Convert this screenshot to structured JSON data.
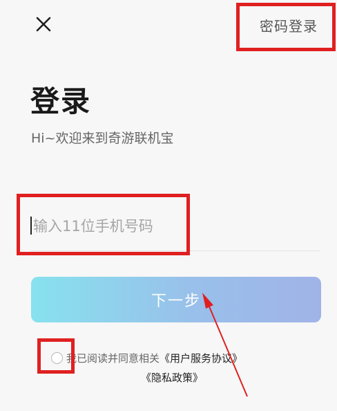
{
  "header": {
    "close_icon": "close-icon",
    "password_login_label": "密码登录"
  },
  "main": {
    "title": "登录",
    "subtitle": "Hi~欢迎来到奇游联机宝",
    "phone_input": {
      "placeholder": "输入11位手机号码",
      "value": ""
    },
    "next_button_label": "下一步",
    "agreement": {
      "checked": false,
      "prefix": "我已阅读并同意相关",
      "user_agreement_link": "《用户服务协议》",
      "privacy_policy_link": "《隐私政策》"
    }
  },
  "colors": {
    "background": "#f7f7f7",
    "annotation_red": "#e02020",
    "button_gradient_start": "#87e2ee",
    "button_gradient_end": "#a0b3e8",
    "button_text": "#ffffff"
  }
}
